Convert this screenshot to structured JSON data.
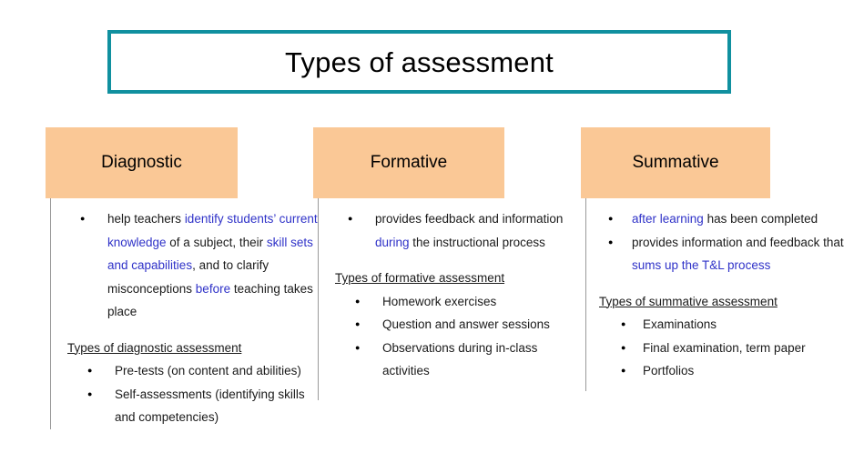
{
  "title": {
    "text": "Types of assessment",
    "border_color": "#10909f"
  },
  "theme": {
    "header_bg": "#fac896",
    "divider": "#9a9a9a",
    "text": "#1a1a1a",
    "highlight": "#2f32c8"
  },
  "columns": [
    {
      "id": "diagnostic",
      "header": "Diagnostic",
      "main_bullets": [
        {
          "segments": [
            {
              "t": "help teachers ",
              "hl": false
            },
            {
              "t": "identify students’ current knowledge",
              "hl": true
            },
            {
              "t": " of a subject, their ",
              "hl": false
            },
            {
              "t": "skill sets and capabilities",
              "hl": true
            },
            {
              "t": ", and to clarify misconceptions ",
              "hl": false
            },
            {
              "t": "before",
              "hl": true
            },
            {
              "t": " teaching takes place",
              "hl": false
            }
          ]
        }
      ],
      "sub_heading": "Types of diagnostic assessment",
      "sub_bullets": [
        "Pre-tests (on content and abilities)",
        "Self-assessments (identifying skills and competencies)"
      ]
    },
    {
      "id": "formative",
      "header": "Formative",
      "main_bullets": [
        {
          "segments": [
            {
              "t": "provides feedback and information ",
              "hl": false
            },
            {
              "t": "during",
              "hl": true
            },
            {
              "t": " the instructional process",
              "hl": false
            }
          ]
        }
      ],
      "sub_heading": "Types of formative assessment",
      "sub_bullets": [
        "Homework exercises",
        "Question and answer sessions",
        "Observations during in-class activities"
      ]
    },
    {
      "id": "summative",
      "header": "Summative",
      "main_bullets": [
        {
          "segments": [
            {
              "t": "after learning",
              "hl": true
            },
            {
              "t": " has been completed",
              "hl": false
            }
          ]
        },
        {
          "segments": [
            {
              "t": "provides information and feedback that ",
              "hl": false
            },
            {
              "t": "sums up the T&L process",
              "hl": true
            }
          ]
        }
      ],
      "sub_heading": "Types of summative assessment",
      "sub_bullets": [
        "Examinations",
        " Final examination, term paper",
        "Portfolios"
      ]
    }
  ]
}
